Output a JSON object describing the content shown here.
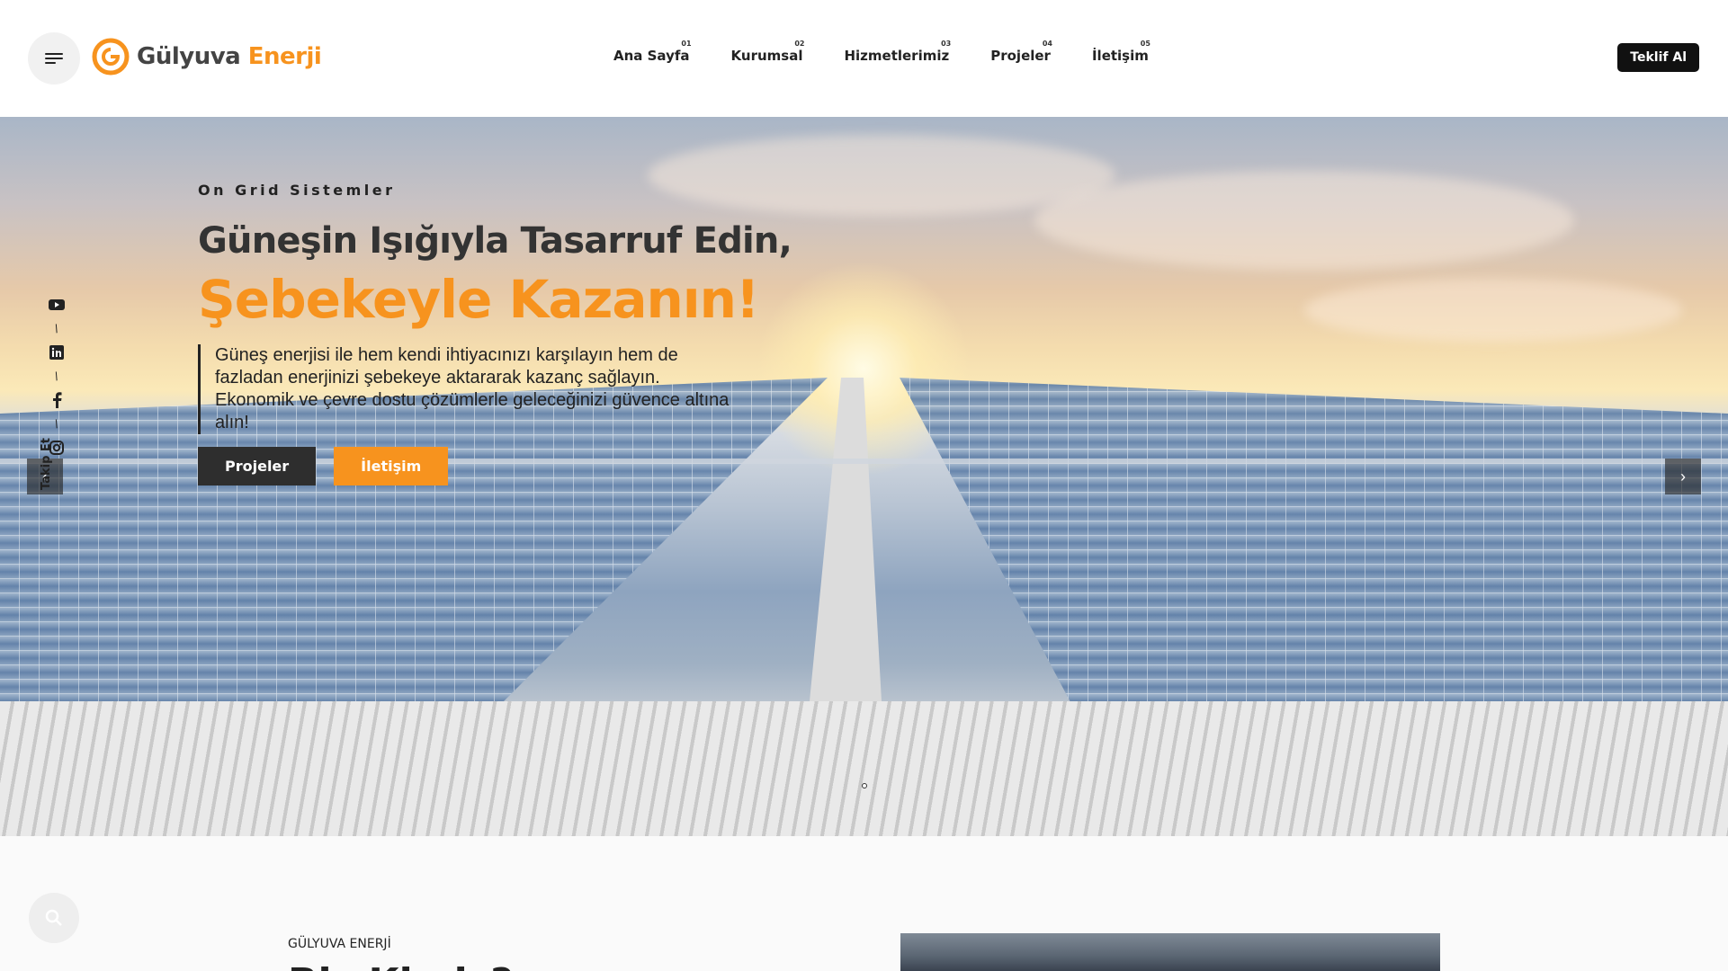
{
  "brand": {
    "name_part1": "Gülyuva",
    "name_part2": "Enerji"
  },
  "nav": [
    {
      "num": "01",
      "label": "Ana Sayfa"
    },
    {
      "num": "02",
      "label": "Kurumsal"
    },
    {
      "num": "03",
      "label": "Hizmetlerimiz"
    },
    {
      "num": "04",
      "label": "Projeler"
    },
    {
      "num": "05",
      "label": "İletişim"
    }
  ],
  "header": {
    "quote_label": "Teklif Al"
  },
  "hero": {
    "eyebrow": "On Grid Sistemler",
    "title_line1": "Güneşin Işığıyla Tasarruf Edin,",
    "title_line2": "Şebekeyle Kazanın!",
    "description": "Güneş enerjisi ile hem kendi ihtiyacınızı karşılayın hem de fazladan enerjinizi şebekeye aktararak kazanç sağlayın. Ekonomik ve çevre dostu çözümlerle geleceğinizi güvence altına alın!",
    "btn_projects": "Projeler",
    "btn_contact": "İletişim"
  },
  "social": {
    "label": "Takip Et",
    "icons": [
      "youtube-icon",
      "linkedin-icon",
      "facebook-icon",
      "instagram-icon"
    ]
  },
  "about": {
    "kicker": "GÜLYUVA ENERJİ",
    "heading": "Biz Kimiz?"
  },
  "colors": {
    "accent": "#f7931e",
    "dark": "#2e2e2e"
  }
}
